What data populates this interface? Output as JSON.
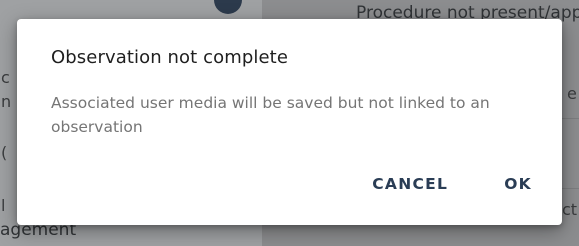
{
  "background": {
    "top_right_text": "Procedure not present/appli",
    "bottom_left_text": "agement",
    "left_fragments": [
      "c",
      "n",
      "(",
      "l"
    ],
    "right_fragments": [
      "e",
      "ct"
    ]
  },
  "dialog": {
    "title": "Observation not complete",
    "body": "Associated user media will be saved but not linked to an observation",
    "cancel_label": "CANCEL",
    "ok_label": "OK"
  },
  "colors": {
    "accent": "#2a3d55",
    "body_text": "#757575",
    "title_text": "#1f1f1f"
  }
}
